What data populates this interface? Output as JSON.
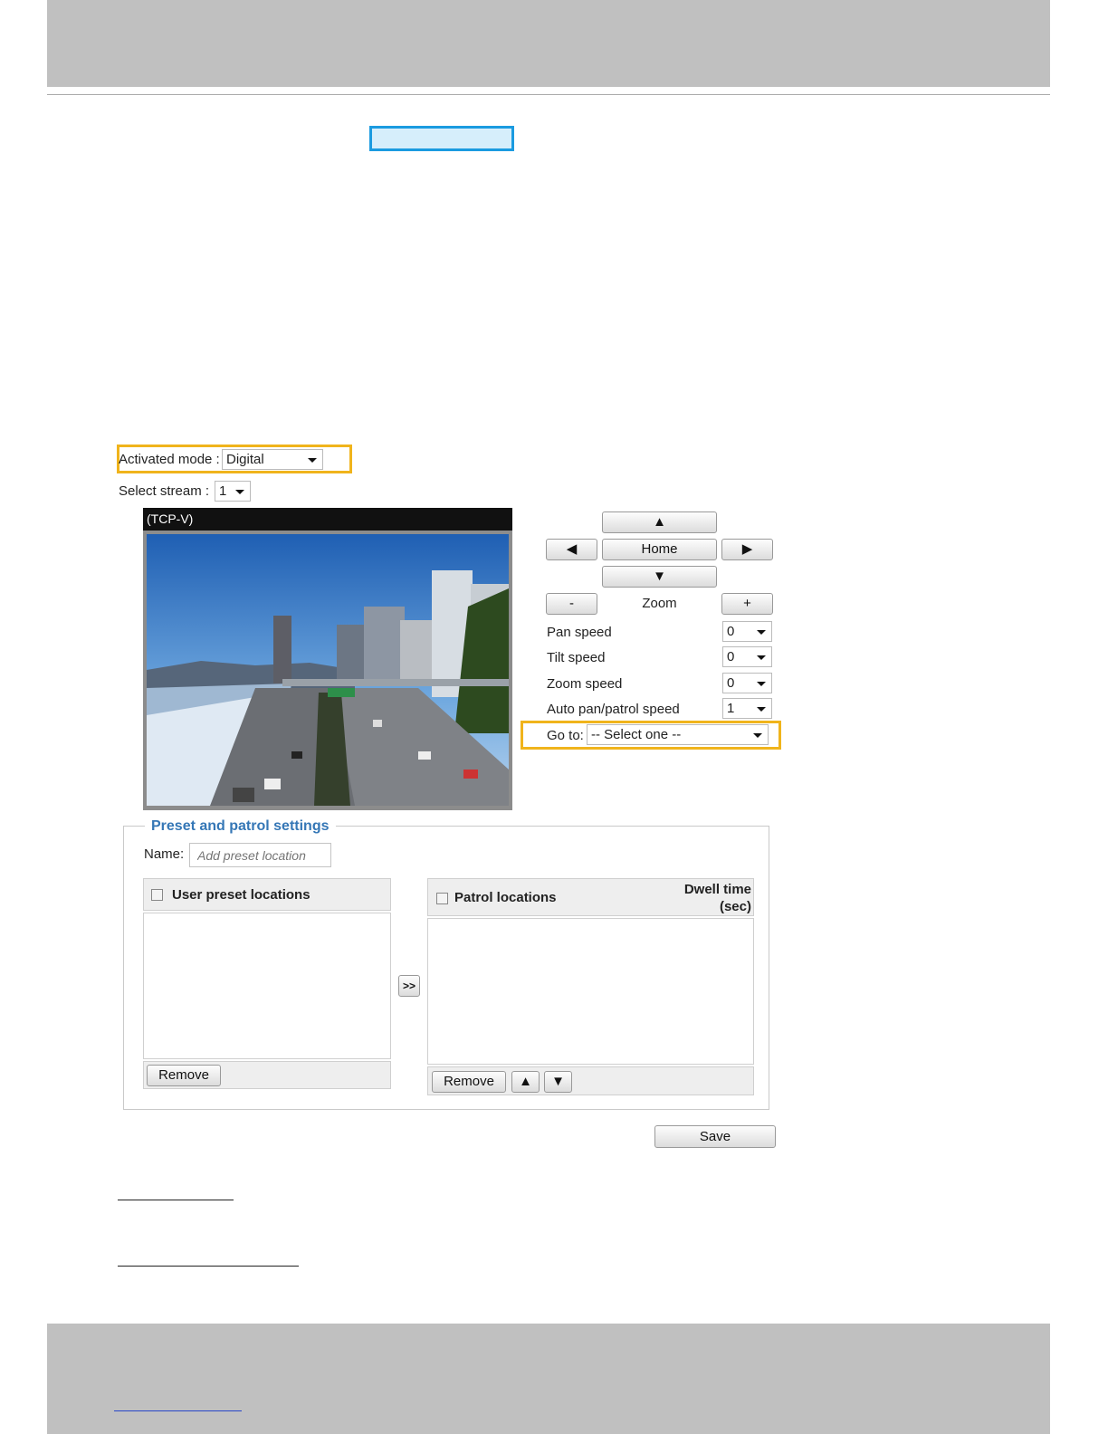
{
  "activated_mode": {
    "label": "Activated mode :",
    "value": "Digital"
  },
  "select_stream": {
    "label": "Select stream :",
    "value": "1"
  },
  "video": {
    "stream_label": "(TCP-V)"
  },
  "ptz": {
    "up_arrow": "▲",
    "left_arrow": "◀",
    "home_label": "Home",
    "right_arrow": "▶",
    "down_arrow": "▼",
    "zoom_out": "-",
    "zoom_label": "Zoom",
    "zoom_in": "+",
    "pan_speed": {
      "label": "Pan speed",
      "value": "0"
    },
    "tilt_speed": {
      "label": "Tilt speed",
      "value": "0"
    },
    "zoom_speed": {
      "label": "Zoom speed",
      "value": "0"
    },
    "auto_pan_speed": {
      "label": "Auto pan/patrol speed",
      "value": "1"
    },
    "go_to": {
      "label": "Go to:",
      "value": "-- Select one --"
    }
  },
  "preset": {
    "legend": "Preset and patrol settings",
    "name_label": "Name:",
    "name_placeholder": "Add preset location",
    "user_presets_header": "User preset locations",
    "remove_label": "Remove",
    "move_label": ">>",
    "patrol_header": "Patrol locations",
    "dwell_time_line1": "Dwell time",
    "dwell_time_line2": "(sec)",
    "patrol_remove_label": "Remove",
    "up_label": "▲",
    "down_label": "▼"
  },
  "save_label": "Save"
}
